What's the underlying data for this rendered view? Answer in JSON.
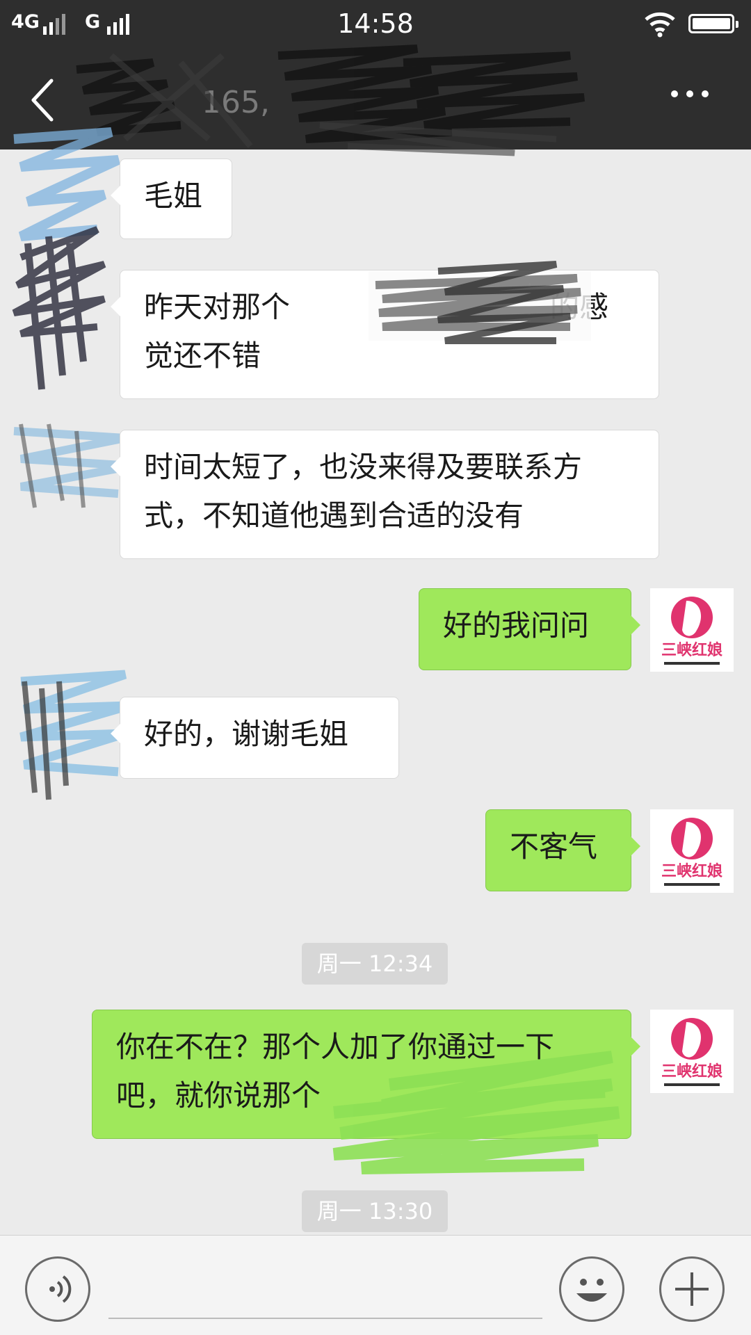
{
  "status_bar": {
    "network_1": "4G",
    "network_2": "G",
    "time": "14:58"
  },
  "header": {
    "contact_name_visible": "165,",
    "back_icon": "chevron-left-icon",
    "more_icon": "more-dots-icon"
  },
  "messages": [
    {
      "side": "in",
      "text": "毛姐"
    },
    {
      "side": "in",
      "lines": [
        "昨天对那个",
        "的感",
        "觉还不错"
      ]
    },
    {
      "side": "in",
      "lines": [
        "时间太短了，也没来得及要联系方",
        "式，不知道他遇到合适的没有"
      ]
    },
    {
      "side": "out",
      "text": "好的我问问"
    },
    {
      "side": "in",
      "text": "好的，谢谢毛姐"
    },
    {
      "side": "out",
      "text": "不客气"
    },
    {
      "side": "out",
      "lines": [
        "你在不在？那个人加了你通过一下",
        "吧，就你说那个"
      ]
    }
  ],
  "timestamps": [
    "周一 12:34",
    "周一 13:30"
  ],
  "avatar_logo": {
    "text": "三峡红娘",
    "accent": "#e0336e"
  },
  "input_bar": {
    "voice_icon": "voice-icon",
    "emoji_icon": "emoji-icon",
    "plus_icon": "plus-icon"
  },
  "colors": {
    "header_bg": "#2e2e2e",
    "chat_bg": "#ebebeb",
    "outgoing_bubble": "#9fe85b",
    "incoming_bubble": "#ffffff"
  }
}
